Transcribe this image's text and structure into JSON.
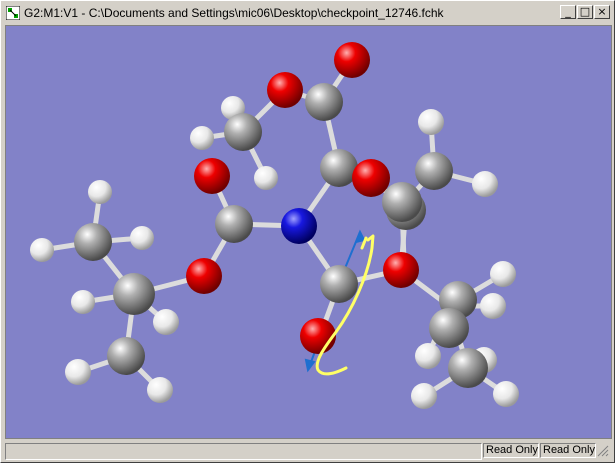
{
  "window": {
    "title": "G2:M1:V1 - C:\\Documents and Settings\\mic06\\Desktop\\checkpoint_12746.fchk",
    "icon": "gaussview-app-icon",
    "controls": {
      "minimize": "_",
      "maximize": "□",
      "close": "×"
    }
  },
  "viewport": {
    "background": "#8282c8",
    "atom_colors": {
      "C": "#8a8a8a",
      "O": "#e00000",
      "N": "#1010d8",
      "H": "#f0f0f0"
    },
    "bond_color": "#d8d8d8",
    "annotation_color": "#ffff66",
    "vector_color": "#1e6fd0"
  },
  "status": {
    "message": "",
    "cell1": "Read Only",
    "cell2": "Read Only"
  }
}
